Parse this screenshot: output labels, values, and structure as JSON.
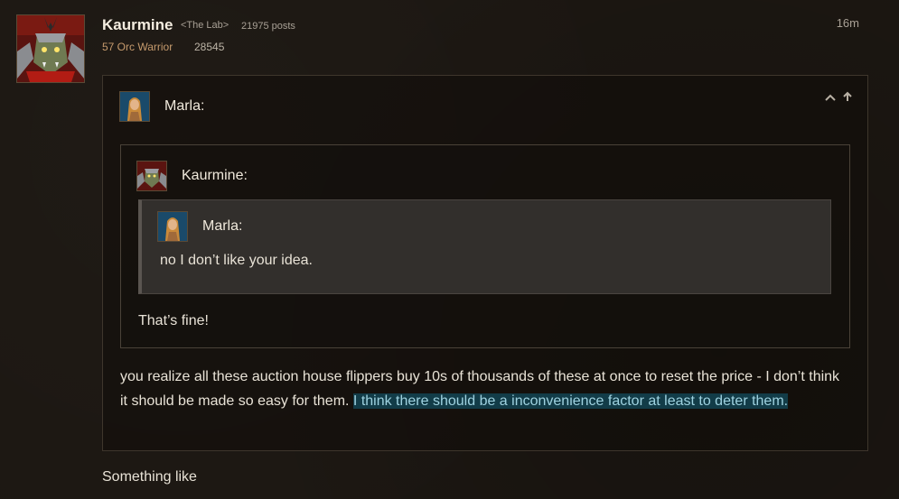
{
  "post": {
    "author": "Kaurmine",
    "guild": "<The Lab>",
    "post_count": "21975 posts",
    "class_info": "57 Orc Warrior",
    "achievement_points": "28545",
    "time_ago": "16m",
    "avatar_icon": "orc-warrior-avatar"
  },
  "quote_outer": {
    "author": "Marla",
    "author_label": "Marla:",
    "avatar_icon": "blood-elf-avatar",
    "controls": [
      "expand-quote-icon",
      "go-to-quoted-post-icon"
    ],
    "body_plain": "you realize all these auction house flippers buy 10s of thousands of these at once to reset the price - I don’t think it should be made so easy for them. ",
    "body_highlighted": "I think there should be a inconvenience factor at least to deter them."
  },
  "quote_mid": {
    "author": "Kaurmine",
    "author_label": "Kaurmine:",
    "avatar_icon": "orc-warrior-avatar",
    "body": "That’s fine!"
  },
  "quote_inner": {
    "author": "Marla",
    "author_label": "Marla:",
    "avatar_icon": "blood-elf-avatar",
    "body": "no I don’t like your idea."
  },
  "reply": {
    "text": "Something like"
  },
  "colors": {
    "background": "#1c1712",
    "class_warrior": "#c69b6d",
    "highlight_bg": "#123c48",
    "highlight_text": "#9ed2e0"
  }
}
